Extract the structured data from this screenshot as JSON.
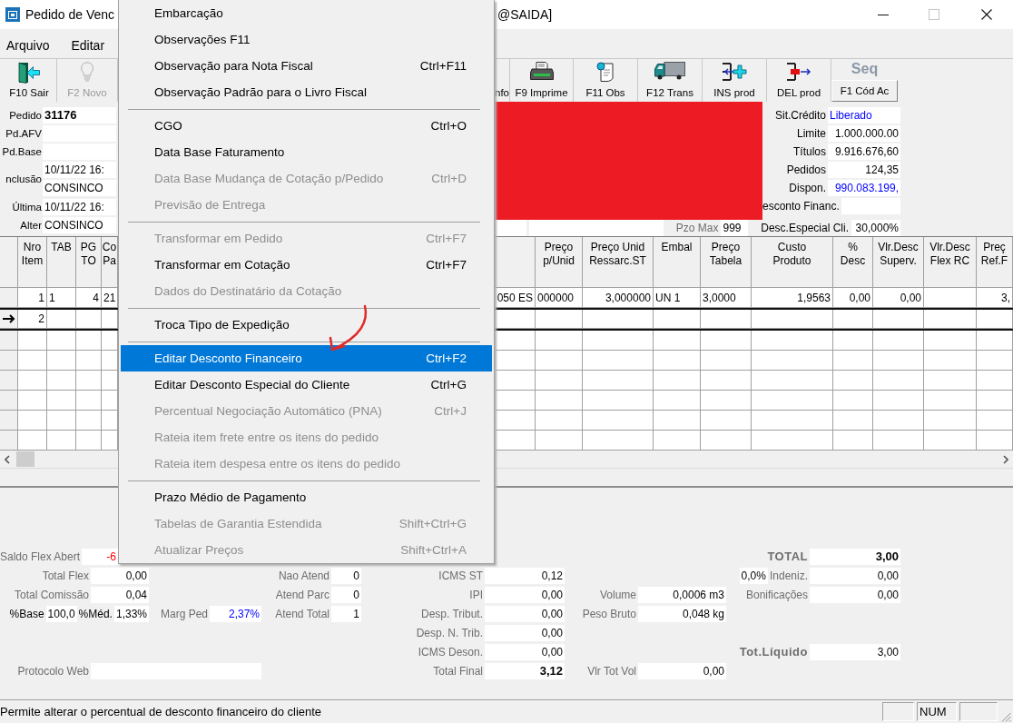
{
  "window": {
    "title_parts": [
      "Pedido de Venc",
      "@SAIDA]"
    ],
    "controls": [
      {
        "kind": "minimize",
        "disabled": false
      },
      {
        "kind": "maximize",
        "disabled": true
      },
      {
        "kind": "close",
        "disabled": false
      }
    ]
  },
  "menubar": [
    "Arquivo",
    "Editar"
  ],
  "toolbar_left": [
    {
      "kind": "exit",
      "label": "F10 Sair",
      "disabled": false
    },
    {
      "kind": "bulb",
      "label": "F2 Novo",
      "disabled": true
    }
  ],
  "toolbar_right": [
    {
      "kind": "text",
      "label": "nfo",
      "disabled": false
    },
    {
      "kind": "print",
      "label": "F9 Imprime",
      "disabled": false
    },
    {
      "kind": "note",
      "label": "F11 Obs",
      "disabled": false
    },
    {
      "kind": "truck",
      "label": "F12 Trans",
      "disabled": false
    },
    {
      "kind": "insert",
      "label": "INS prod",
      "disabled": false
    },
    {
      "kind": "delete",
      "label": "DEL prod",
      "disabled": false
    },
    {
      "kind": "seq",
      "caption": "Seq",
      "label": "F1 Cód Ac",
      "disabled": false
    }
  ],
  "order_fields": [
    {
      "label": "Pedido",
      "values": [
        "31176"
      ],
      "bold": true
    },
    {
      "label": "Pd.AFV"
    },
    {
      "label": "Pd.Base"
    },
    {
      "label": "nclusão",
      "values": [
        "10/11/22 16:",
        "CONSINCO"
      ]
    },
    {
      "label": "Última Alter",
      "values": [
        "10/11/22 16:",
        "CONSINCO"
      ]
    }
  ],
  "credit_fields": [
    {
      "label": "Sit.Crédito",
      "value": "Liberado",
      "color": "#0000ff"
    },
    {
      "label": "Limite",
      "value": "1.000.000.00"
    },
    {
      "label": "Títulos",
      "value": "9.916.676,60"
    },
    {
      "label": "Pedidos",
      "value": "124,35"
    },
    {
      "label": "Dispon.",
      "value": "990.083.199,",
      "color": "#0000ff"
    },
    {
      "label": "esconto Financ."
    }
  ],
  "terms_row": [
    {
      "kind": "field"
    },
    {
      "kind": "field"
    },
    {
      "kind": "label",
      "text": "Pzo Max",
      "disabled": true
    },
    {
      "kind": "field",
      "value": "999"
    },
    {
      "kind": "label",
      "text": "Desc.Especial Cli.",
      "disabled": false
    },
    {
      "kind": "field",
      "value": "30,000%"
    }
  ],
  "table": {
    "rows": [
      {
        "selected": false
      },
      {
        "selected": true
      }
    ],
    "left_columns": [
      {
        "header": [
          "Nro",
          "Item"
        ],
        "cells": [
          "1",
          "2"
        ]
      },
      {
        "header": [
          "TAB"
        ],
        "cells": [
          "1"
        ]
      },
      {
        "header": [
          "PG",
          "TO"
        ],
        "cells": [
          "4"
        ]
      },
      {
        "header": [
          "Co",
          "Pa"
        ],
        "cells": [
          "21"
        ]
      }
    ],
    "right_columns": [
      {
        "cells": [
          "050 ES"
        ]
      },
      {
        "header": [
          "Preço",
          "p/Unid"
        ],
        "cells": [
          "000000"
        ]
      },
      {
        "header": [
          "Preço Unid",
          "Ressarc.ST"
        ],
        "cells": [
          "3,000000"
        ]
      },
      {
        "header": [
          "Embal"
        ],
        "cells": [
          "UN 1"
        ]
      },
      {
        "header": [
          "Preço",
          "Tabela"
        ],
        "cells": [
          "3,0000"
        ]
      },
      {
        "header": [
          "Custo",
          "Produto"
        ],
        "cells": [
          "1,9563"
        ]
      },
      {
        "header": [
          "%",
          "Desc"
        ],
        "cells": [
          "0,00"
        ]
      },
      {
        "header": [
          "Vlr.Desc",
          "Superv."
        ],
        "cells": [
          "0,00"
        ]
      },
      {
        "header": [
          "Vlr.Desc",
          "Flex RC"
        ]
      },
      {
        "header": [
          "Preç",
          "Ref.F"
        ],
        "cells": [
          "3,"
        ]
      }
    ]
  },
  "context_menu": {
    "items": [
      {
        "kind": "item",
        "label": "Embarcação",
        "disabled": false,
        "selected": false
      },
      {
        "kind": "item",
        "label": "Observações F11",
        "disabled": false,
        "selected": false
      },
      {
        "kind": "item",
        "label": "Observação para Nota Fiscal",
        "shortcut": "Ctrl+F11",
        "disabled": false,
        "selected": false
      },
      {
        "kind": "item",
        "label": "Observação Padrão para o Livro Fiscal",
        "disabled": false,
        "selected": false
      },
      {
        "kind": "separator"
      },
      {
        "kind": "item",
        "label": "CGO",
        "shortcut": "Ctrl+O",
        "disabled": false,
        "selected": false
      },
      {
        "kind": "item",
        "label": "Data Base Faturamento",
        "disabled": false,
        "selected": false
      },
      {
        "kind": "item",
        "label": "Data Base Mudança de Cotação p/Pedido",
        "shortcut": "Ctrl+D",
        "disabled": true,
        "selected": false
      },
      {
        "kind": "item",
        "label": "Previsão de Entrega",
        "disabled": true,
        "selected": false
      },
      {
        "kind": "separator"
      },
      {
        "kind": "item",
        "label": "Transformar em Pedido",
        "shortcut": "Ctrl+F7",
        "disabled": true,
        "selected": false
      },
      {
        "kind": "item",
        "label": "Transformar em Cotação",
        "shortcut": "Ctrl+F7",
        "disabled": false,
        "selected": false
      },
      {
        "kind": "item",
        "label": "Dados do Destinatário da Cotação",
        "disabled": true,
        "selected": false
      },
      {
        "kind": "separator"
      },
      {
        "kind": "item",
        "label": "Troca Tipo de Expedição",
        "disabled": false,
        "selected": false
      },
      {
        "kind": "separator"
      },
      {
        "kind": "item",
        "label": "Editar Desconto Financeiro",
        "shortcut": "Ctrl+F2",
        "disabled": false,
        "selected": true
      },
      {
        "kind": "item",
        "label": "Editar Desconto Especial do Cliente",
        "shortcut": "Ctrl+G",
        "disabled": false,
        "selected": false
      },
      {
        "kind": "item",
        "label": "Percentual Negociação Automático (PNA)",
        "shortcut": "Ctrl+J",
        "disabled": true,
        "selected": false
      },
      {
        "kind": "item",
        "label": "Rateia item frete entre os itens do pedido",
        "disabled": true,
        "selected": false
      },
      {
        "kind": "item",
        "label": "Rateia item despesa entre os itens do pedido",
        "disabled": true,
        "selected": false
      },
      {
        "kind": "separator"
      },
      {
        "kind": "item",
        "label": "Prazo Médio de Pagamento",
        "disabled": false,
        "selected": false
      },
      {
        "kind": "item",
        "label": "Tabelas de Garantia Estendida",
        "shortcut": "Shift+Ctrl+G",
        "disabled": true,
        "selected": false
      },
      {
        "kind": "item",
        "label": "Atualizar Preços",
        "shortcut": "Shift+Ctrl+A",
        "disabled": true,
        "selected": false
      }
    ]
  },
  "summary": {
    "rows": [
      [
        [
          {
            "kind": "label",
            "text": "Saldo Flex Abert",
            "disabled": true
          },
          {
            "kind": "field",
            "value": "-6",
            "color": "#ff0000"
          }
        ],
        null,
        null,
        null,
        null,
        [
          {
            "kind": "label",
            "text": "TOTAL",
            "disabled": true,
            "bold": true
          },
          {
            "kind": "field",
            "value": "3,00",
            "bold": true
          }
        ]
      ],
      [
        [
          {
            "kind": "label",
            "text": "Total Flex",
            "disabled": true
          },
          {
            "kind": "field",
            "value": "0,00"
          }
        ],
        null,
        [
          {
            "kind": "label",
            "text": "Nao Atend",
            "disabled": true
          },
          {
            "kind": "field",
            "value": "0"
          }
        ],
        [
          {
            "kind": "label",
            "text": "ICMS ST",
            "disabled": true
          },
          {
            "kind": "field",
            "value": "0,12"
          }
        ],
        null,
        [
          {
            "kind": "field",
            "value": "0,0%"
          },
          {
            "kind": "label",
            "text": "Indeniz.",
            "disabled": true
          },
          {
            "kind": "field",
            "value": "0,00"
          }
        ]
      ],
      [
        [
          {
            "kind": "label",
            "text": "Total Comissão",
            "disabled": true
          },
          {
            "kind": "field",
            "value": "0,04"
          }
        ],
        null,
        [
          {
            "kind": "label",
            "text": "Atend Parc",
            "disabled": true
          },
          {
            "kind": "field",
            "value": "0"
          }
        ],
        [
          {
            "kind": "label",
            "text": "IPI",
            "disabled": true
          },
          {
            "kind": "field",
            "value": "0,00"
          }
        ],
        [
          {
            "kind": "label",
            "text": "Volume",
            "disabled": true
          },
          {
            "kind": "field",
            "value": "0,0006 m3"
          }
        ],
        [
          {
            "kind": "label",
            "text": "Bonificações",
            "disabled": true
          },
          {
            "kind": "field",
            "value": "0,00"
          }
        ]
      ],
      [
        [
          {
            "kind": "label",
            "text": "%Base",
            "disabled": false
          },
          {
            "kind": "field",
            "value": "100,0"
          },
          {
            "kind": "label",
            "text": "%Méd.",
            "disabled": false
          },
          {
            "kind": "field",
            "value": "1,33%"
          }
        ],
        [
          {
            "kind": "label",
            "text": "Marg Ped",
            "disabled": true
          },
          {
            "kind": "field",
            "value": "2,37%",
            "color": "#0000ff"
          }
        ],
        [
          {
            "kind": "label",
            "text": "Atend Total",
            "disabled": true
          },
          {
            "kind": "field",
            "value": "1"
          }
        ],
        [
          {
            "kind": "label",
            "text": "Desp. Tribut.",
            "disabled": true
          },
          {
            "kind": "field",
            "value": "0,00"
          }
        ],
        [
          {
            "kind": "label",
            "text": "Peso Bruto",
            "disabled": true
          },
          {
            "kind": "field",
            "value": "0,048 kg"
          }
        ],
        null
      ],
      [
        null,
        null,
        null,
        [
          {
            "kind": "label",
            "text": "Desp. N. Trib.",
            "disabled": true
          },
          {
            "kind": "field",
            "value": "0,00"
          }
        ],
        null,
        null
      ],
      [
        null,
        null,
        null,
        [
          {
            "kind": "label",
            "text": "ICMS Deson.",
            "disabled": true
          },
          {
            "kind": "field",
            "value": "0,00"
          }
        ],
        null,
        [
          {
            "kind": "label",
            "text": "Tot.Líquido",
            "disabled": true,
            "bold": true
          },
          {
            "kind": "field",
            "value": "3,00"
          }
        ]
      ],
      [
        [
          {
            "kind": "label",
            "text": "Protocolo Web",
            "disabled": true
          },
          {
            "kind": "field"
          }
        ],
        null,
        null,
        [
          {
            "kind": "label",
            "text": "Total Final",
            "disabled": true
          },
          {
            "kind": "field",
            "value": "3,12",
            "bold": true
          }
        ],
        [
          {
            "kind": "label",
            "text": "Vlr Tot Vol",
            "disabled": true
          },
          {
            "kind": "field",
            "value": "0,00"
          }
        ],
        null
      ]
    ]
  },
  "status_bar": {
    "message": "Permite alterar o percentual de desconto financeiro do cliente",
    "indicator": "NUM"
  }
}
